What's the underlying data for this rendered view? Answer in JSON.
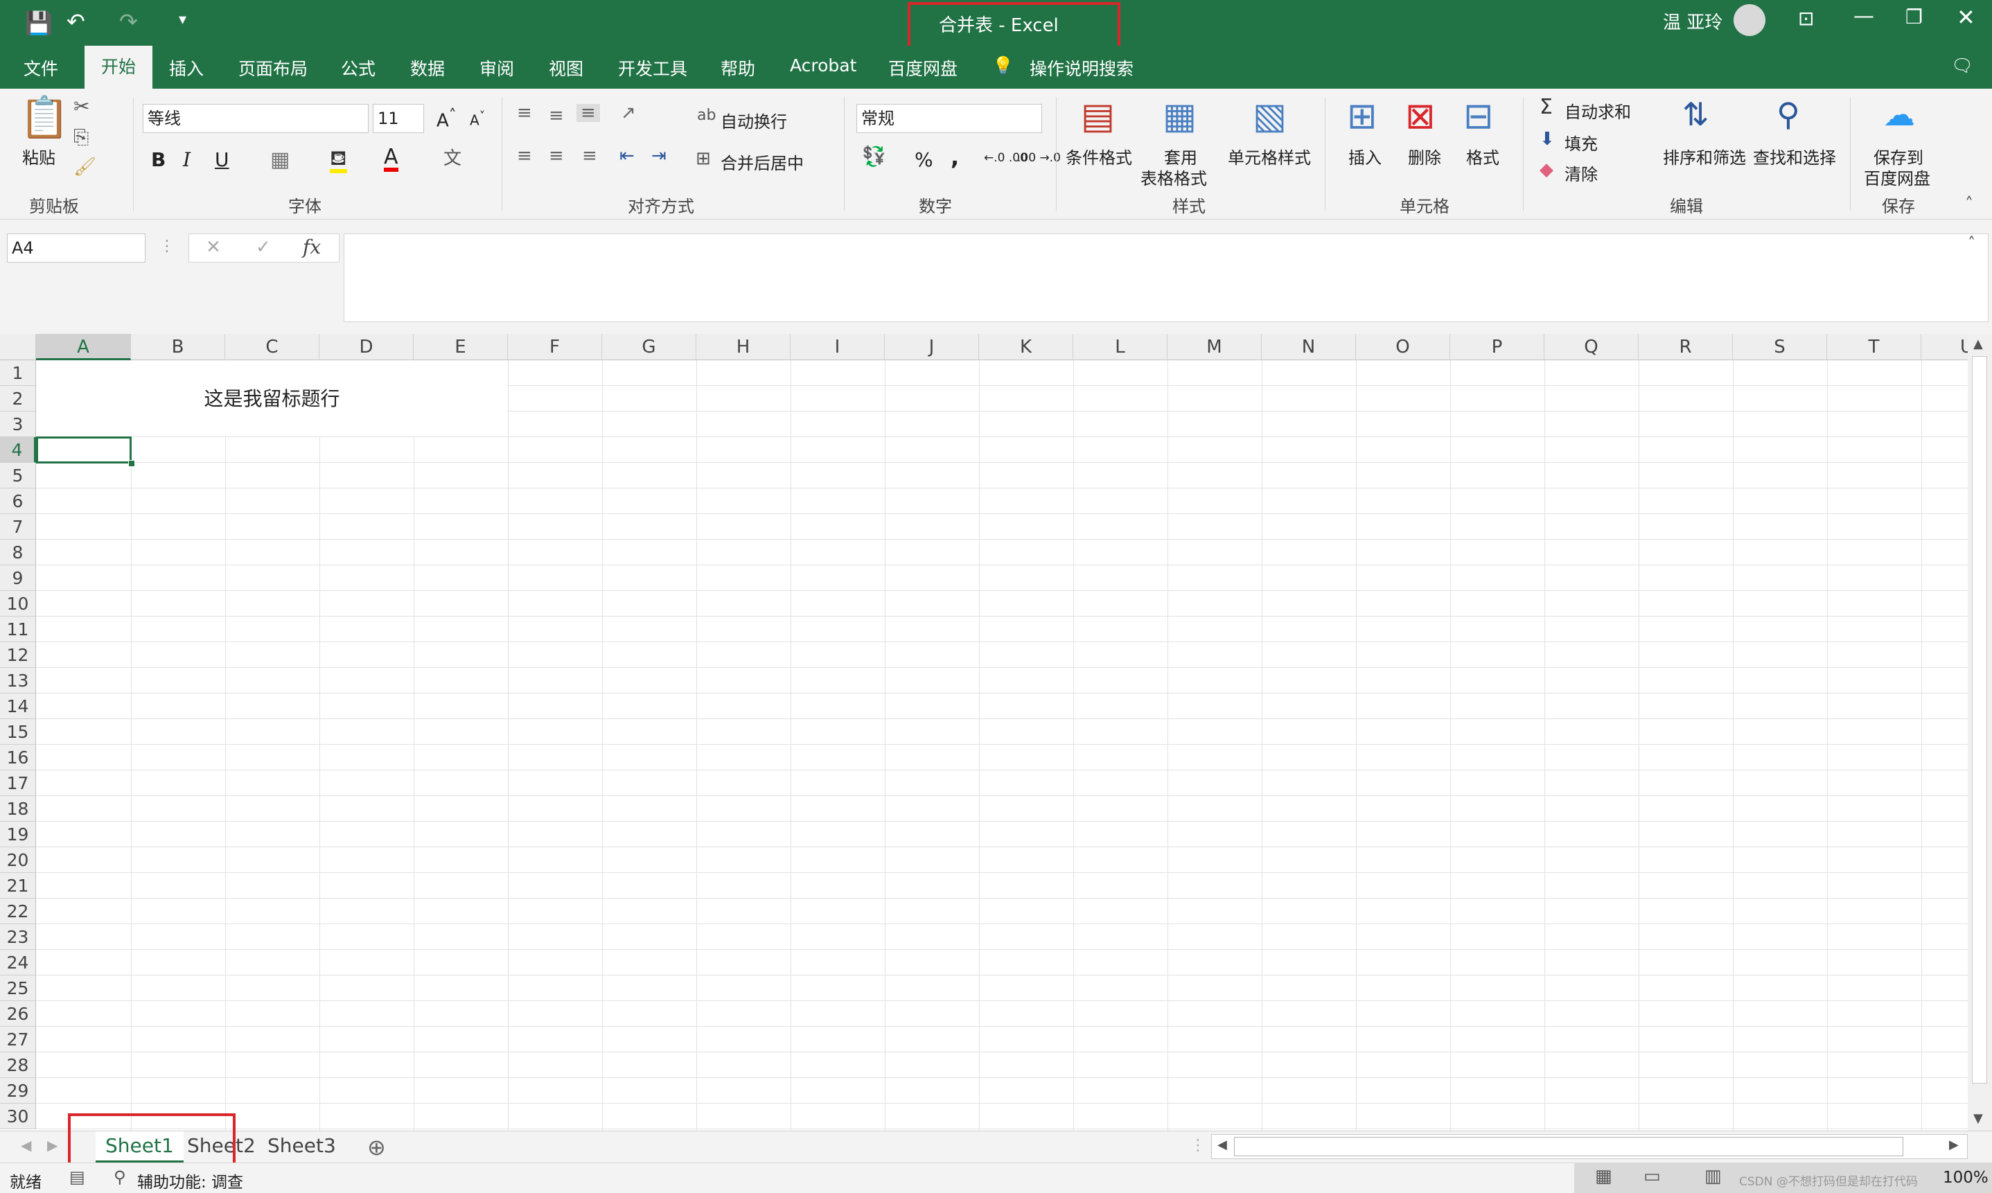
{
  "window": {
    "title": "合并表  -  Excel",
    "user": "温 亚玲"
  },
  "tabs": [
    "文件",
    "开始",
    "插入",
    "页面布局",
    "公式",
    "数据",
    "审阅",
    "视图",
    "开发工具",
    "帮助",
    "Acrobat",
    "百度网盘"
  ],
  "active_tab": "开始",
  "tell_me": "操作说明搜索",
  "ribbon": {
    "clipboard": {
      "paste": "粘贴",
      "group": "剪贴板"
    },
    "font": {
      "name": "等线",
      "size": "11",
      "bold": "B",
      "italic": "I",
      "underline": "U",
      "font_color": "A",
      "group": "字体"
    },
    "alignment": {
      "wrap": "自动换行",
      "merge": "合并后居中",
      "group": "对齐方式"
    },
    "number": {
      "format": "常规",
      "percent": "%",
      "comma": ",",
      "inc_dec": "←.0 .00",
      "dec_dec": ".00 →.0",
      "group": "数字"
    },
    "styles": {
      "conditional": "条件格式",
      "table_fmt_1": "套用",
      "table_fmt_2": "表格格式",
      "cell_styles": "单元格样式",
      "group": "样式"
    },
    "cells": {
      "insert": "插入",
      "delete": "删除",
      "format": "格式",
      "group": "单元格"
    },
    "editing": {
      "autosum": "自动求和",
      "fill": "填充",
      "clear": "清除",
      "sort": "排序和筛选",
      "find": "查找和选择",
      "group": "编辑"
    },
    "save": {
      "line1": "保存到",
      "line2": "百度网盘",
      "group": "保存"
    }
  },
  "formula_bar": {
    "name_box": "A4",
    "fx": "fx",
    "value": ""
  },
  "columns": [
    "A",
    "B",
    "C",
    "D",
    "E",
    "F",
    "G",
    "H",
    "I",
    "J",
    "K",
    "L",
    "M",
    "N",
    "O",
    "P",
    "Q",
    "R",
    "S",
    "T",
    "U"
  ],
  "rows": [
    "1",
    "2",
    "3",
    "4",
    "5",
    "6",
    "7",
    "8",
    "9",
    "10",
    "11",
    "12",
    "13",
    "14",
    "15",
    "16",
    "17",
    "18",
    "19",
    "20",
    "21",
    "22",
    "23",
    "24",
    "25",
    "26",
    "27",
    "28",
    "29",
    "30"
  ],
  "cells": {
    "merged_title": "这是我留标题行"
  },
  "selected_cell": "A4",
  "sheets": [
    "Sheet1",
    "Sheet2",
    "Sheet3"
  ],
  "active_sheet": "Sheet1",
  "status": {
    "ready": "就绪",
    "accessibility": "辅助功能: 调查",
    "zoom": "100%",
    "watermark": "CSDN @不想打码但是却在打代码"
  },
  "colors": {
    "excel_green": "#217346",
    "highlight_red": "#d9262b"
  }
}
